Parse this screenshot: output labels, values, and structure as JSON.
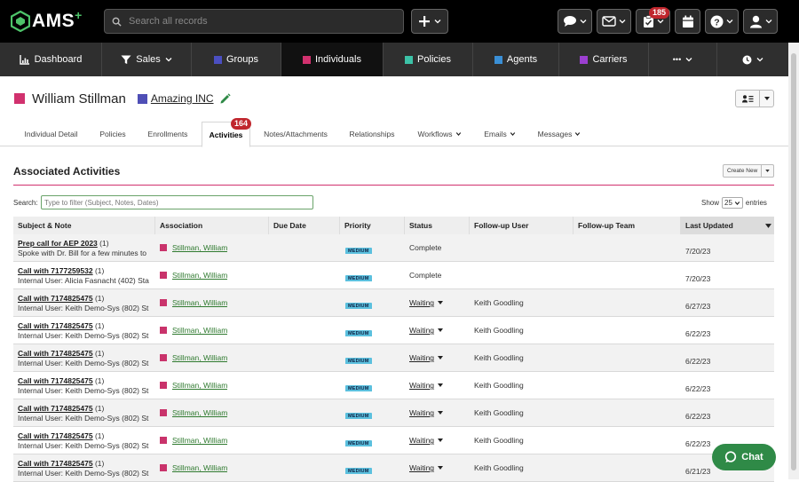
{
  "header": {
    "brand": "AMS",
    "brand_plus": "+",
    "search_placeholder": "Search all records",
    "tasks_badge": "185"
  },
  "nav": {
    "items": [
      {
        "label": "Dashboard",
        "icon": "chart-icon"
      },
      {
        "label": "Sales",
        "icon": "funnel-icon"
      },
      {
        "label": "Groups",
        "color": "#4b4fc1"
      },
      {
        "label": "Individuals",
        "color": "#d1316e"
      },
      {
        "label": "Policies",
        "color": "#3cc2a7"
      },
      {
        "label": "Agents",
        "color": "#3a8fd6"
      },
      {
        "label": "Carriers",
        "color": "#9b3fd0"
      },
      {
        "label": "•••"
      }
    ]
  },
  "record": {
    "name": "William Stillman",
    "company": "Amazing INC"
  },
  "tabs": [
    {
      "label": "Individual Detail"
    },
    {
      "label": "Policies"
    },
    {
      "label": "Enrollments"
    },
    {
      "label": "Activities",
      "badge": "164"
    },
    {
      "label": "Notes/Attachments"
    },
    {
      "label": "Relationships"
    },
    {
      "label": "Workflows"
    },
    {
      "label": "Emails"
    },
    {
      "label": "Messages"
    }
  ],
  "activities": {
    "title": "Associated Activities",
    "create_label": "Create New",
    "search_label": "Search:",
    "filter_placeholder": "Type to filter (Subject, Notes, Dates)",
    "show_label": "Show",
    "show_value": "25",
    "entries_label": "entries",
    "columns": [
      "Subject & Note",
      "Association",
      "Due Date",
      "Priority",
      "Status",
      "Follow-up User",
      "Follow-up Team",
      "Last Updated"
    ],
    "rows": [
      {
        "subject": "Prep call for AEP 2023",
        "count": "(1)",
        "note": "Spoke with Dr. Bill for a few minutes to",
        "association": "Stillman, William",
        "priority": "MEDIUM",
        "status": "Complete",
        "user": "",
        "updated": "7/20/23"
      },
      {
        "subject": "Call with 7177259532",
        "count": "(1)",
        "note": "Internal User: Alicia Fasnacht (402) Sta",
        "association": "Stillman, William",
        "priority": "MEDIUM",
        "status": "Complete",
        "user": "",
        "updated": "7/20/23"
      },
      {
        "subject": "Call with 7174825475",
        "count": "(1)",
        "note": "Internal User: Keith Demo-Sys (802) St",
        "association": "Stillman, William",
        "priority": "MEDIUM",
        "status": "Waiting",
        "user": "Keith Goodling",
        "updated": "6/27/23"
      },
      {
        "subject": "Call with 7174825475",
        "count": "(1)",
        "note": "Internal User: Keith Demo-Sys (802) St",
        "association": "Stillman, William",
        "priority": "MEDIUM",
        "status": "Waiting",
        "user": "Keith Goodling",
        "updated": "6/22/23"
      },
      {
        "subject": "Call with 7174825475",
        "count": "(1)",
        "note": "Internal User: Keith Demo-Sys (802) St",
        "association": "Stillman, William",
        "priority": "MEDIUM",
        "status": "Waiting",
        "user": "Keith Goodling",
        "updated": "6/22/23"
      },
      {
        "subject": "Call with 7174825475",
        "count": "(1)",
        "note": "Internal User: Keith Demo-Sys (802) St",
        "association": "Stillman, William",
        "priority": "MEDIUM",
        "status": "Waiting",
        "user": "Keith Goodling",
        "updated": "6/22/23"
      },
      {
        "subject": "Call with 7174825475",
        "count": "(1)",
        "note": "Internal User: Keith Demo-Sys (802) St",
        "association": "Stillman, William",
        "priority": "MEDIUM",
        "status": "Waiting",
        "user": "Keith Goodling",
        "updated": "6/22/23"
      },
      {
        "subject": "Call with 7174825475",
        "count": "(1)",
        "note": "Internal User: Keith Demo-Sys (802) St",
        "association": "Stillman, William",
        "priority": "MEDIUM",
        "status": "Waiting",
        "user": "Keith Goodling",
        "updated": "6/22/23"
      },
      {
        "subject": "Call with 7174825475",
        "count": "(1)",
        "note": "Internal User: Keith Demo-Sys (802) St",
        "association": "Stillman, William",
        "priority": "MEDIUM",
        "status": "Waiting",
        "user": "Keith Goodling",
        "updated": "6/21/23"
      }
    ]
  },
  "chat": {
    "label": "Chat"
  }
}
